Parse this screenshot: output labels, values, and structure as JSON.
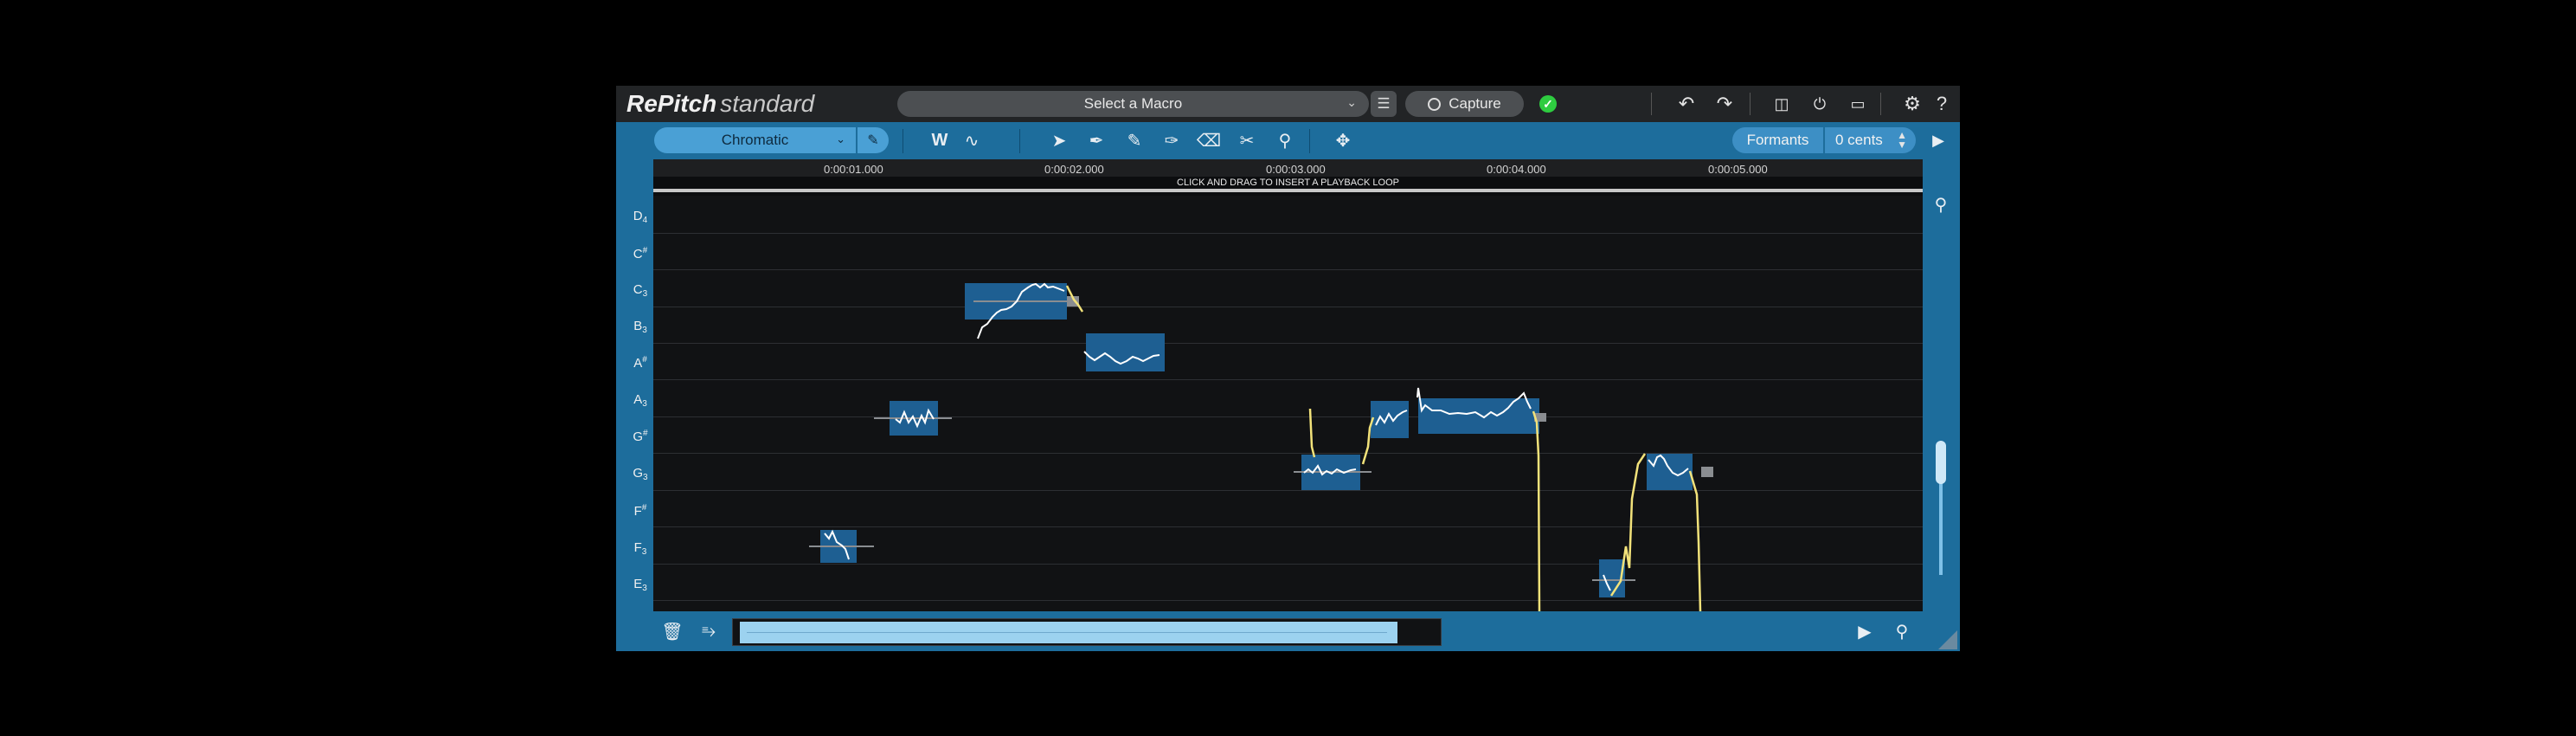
{
  "app": {
    "name": "RePitch",
    "edition": "standard"
  },
  "header": {
    "macro_placeholder": "Select a Macro",
    "capture_label": "Capture",
    "status_icon": "checkmark-icon"
  },
  "toolbar": {
    "scale_mode": "Chromatic",
    "formants_label": "Formants",
    "cents_value": "0 cents"
  },
  "timeline": {
    "ticks": [
      "0:00:01.000",
      "0:00:02.000",
      "0:00:03.000",
      "0:00:04.000",
      "0:00:05.000"
    ],
    "loop_hint": "CLICK AND DRAG TO INSERT A PLAYBACK LOOP"
  },
  "pitch_rows": [
    {
      "note": "D",
      "accidental": "",
      "octave": "4"
    },
    {
      "note": "C",
      "accidental": "#",
      "octave": ""
    },
    {
      "note": "C",
      "accidental": "",
      "octave": "3"
    },
    {
      "note": "B",
      "accidental": "",
      "octave": "3"
    },
    {
      "note": "A",
      "accidental": "#",
      "octave": ""
    },
    {
      "note": "A",
      "accidental": "",
      "octave": "3"
    },
    {
      "note": "G",
      "accidental": "#",
      "octave": ""
    },
    {
      "note": "G",
      "accidental": "",
      "octave": "3"
    },
    {
      "note": "F",
      "accidental": "#",
      "octave": ""
    },
    {
      "note": "F",
      "accidental": "",
      "octave": "3"
    },
    {
      "note": "E",
      "accidental": "",
      "octave": "3"
    }
  ],
  "colors": {
    "accent": "#1d6d9c",
    "note_block": "#1e5f92",
    "pitch_trace": "#ffffff",
    "pitch_transition": "#f2e27a",
    "status_ok": "#2ecc40"
  }
}
